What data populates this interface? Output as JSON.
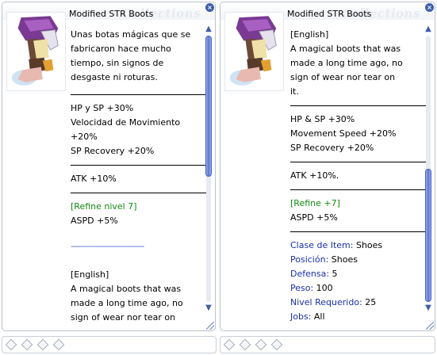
{
  "left_panel": {
    "title": "Modified STR Boots",
    "watermark": "Collections",
    "description_lines": [
      "Unas botas mágicas que se",
      "fabricaron hace mucho",
      "tiempo, sin signos de",
      "desgaste ni roturas."
    ],
    "stats_lines": [
      "HP y SP +30%",
      "Velocidad de Movimiento",
      "+20%",
      "SP Recovery +20%"
    ],
    "atk_line": "ATK +10%",
    "refine_label": "[Refine nivel 7]",
    "refine_bonus": "ASPD +5%",
    "separator": "-------------------------------",
    "english_header": "[English]",
    "english_lines": [
      "A magical boots that was",
      "made a long time ago, no",
      "sign of wear nor tear on"
    ],
    "scroll_position": 0.0,
    "scroll_visible_fraction": 0.53
  },
  "right_panel": {
    "title": "Modified STR Boots",
    "watermark": "Collections",
    "description_lines": [
      "[English]",
      "A magical boots that was",
      "made a long time ago, no",
      "sign of wear nor tear on",
      "it."
    ],
    "stats_lines": [
      "HP & SP +30%",
      "Movement Speed +20%",
      "SP Recovery +20%"
    ],
    "atk_line": "ATK +10%.",
    "refine_label": "[Refine +7]",
    "refine_bonus": "ASPD +5%",
    "properties": [
      {
        "label": "Clase de Item:",
        "value": " Shoes"
      },
      {
        "label": "Posición:",
        "value": " Shoes"
      },
      {
        "label": "Defensa:",
        "value": " 5"
      },
      {
        "label": "Peso:",
        "value": " 100"
      },
      {
        "label": "Nivel Requerido:",
        "value": " 25"
      },
      {
        "label": "Jobs:",
        "value": " All"
      }
    ],
    "scroll_position": 1.0,
    "scroll_visible_fraction": 0.5
  },
  "icons": {
    "close": "close-icon",
    "scroll_up": "arrow-up-icon",
    "scroll_down": "arrow-down-icon",
    "resize": "resize-grip-icon",
    "slot": "card-slot-icon"
  },
  "colors": {
    "refine_green": "#118a11",
    "label_blue": "#1a2fa8",
    "scroll_blue": "#5a74d8",
    "window_border": "#b9c2cc"
  }
}
